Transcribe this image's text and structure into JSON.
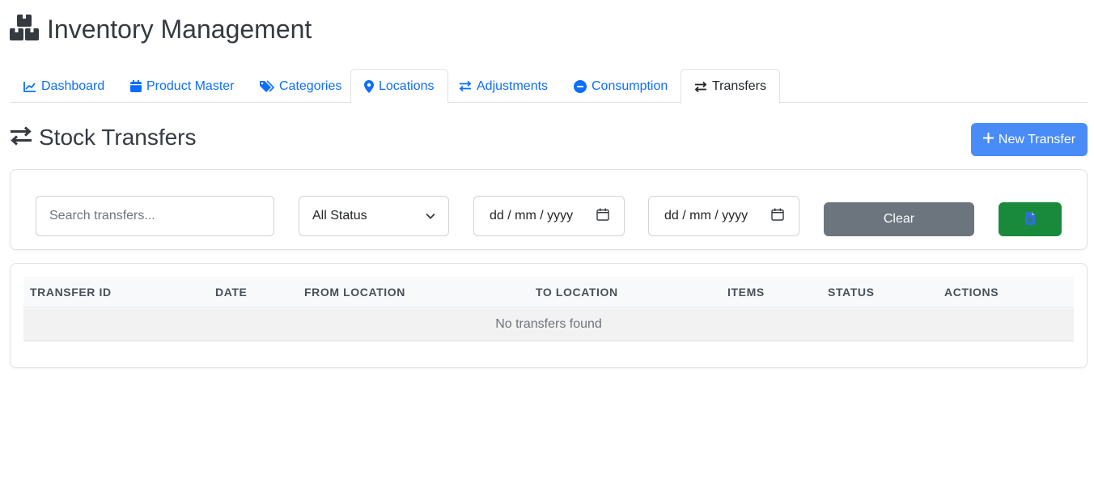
{
  "app": {
    "title": "Inventory Management",
    "icon": "boxes-icon"
  },
  "tabs": [
    {
      "label": "Dashboard",
      "icon": "chart-line-icon"
    },
    {
      "label": "Product Master",
      "icon": "calendar-icon"
    },
    {
      "label": "Categories",
      "icon": "tags-icon"
    },
    {
      "label": "Locations",
      "icon": "map-marker-icon"
    },
    {
      "label": "Adjustments",
      "icon": "exchange-icon"
    },
    {
      "label": "Consumption",
      "icon": "minus-circle-icon"
    },
    {
      "label": "Transfers",
      "icon": "exchange-icon",
      "active": true
    }
  ],
  "section": {
    "title": "Stock Transfers",
    "icon": "exchange-icon"
  },
  "actions": {
    "new_transfer": "New Transfer"
  },
  "filters": {
    "search_placeholder": "Search transfers...",
    "status_selected": "All Status",
    "date_from_placeholder": "dd / mm / yyyy",
    "date_to_placeholder": "dd / mm / yyyy",
    "clear_label": "Clear",
    "export_icon": "file-excel-icon"
  },
  "table": {
    "columns": [
      "TRANSFER ID",
      "DATE",
      "FROM LOCATION",
      "TO LOCATION",
      "ITEMS",
      "STATUS",
      "ACTIONS"
    ],
    "empty_message": "No transfers found"
  },
  "colors": {
    "primary": "#0d6efd",
    "new_button": "#4a8cf7",
    "secondary": "#6c757d",
    "success": "#198a3c"
  }
}
